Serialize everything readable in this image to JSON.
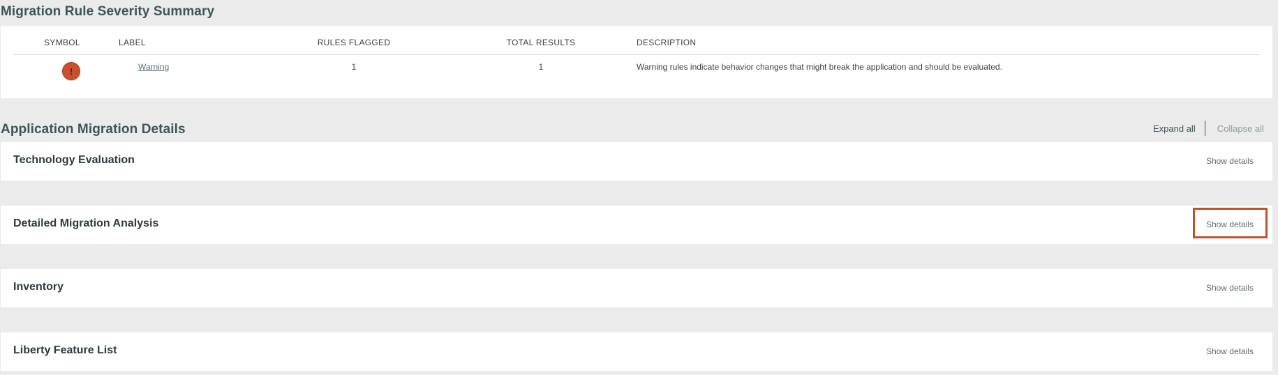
{
  "summary": {
    "title": "Migration Rule Severity Summary",
    "columns": {
      "symbol": "SYMBOL",
      "label": "LABEL",
      "rules_flagged": "RULES FLAGGED",
      "total_results": "TOTAL RESULTS",
      "description": "DESCRIPTION"
    },
    "rows": [
      {
        "symbol_icon": "warning-icon",
        "symbol_color": "#c9502f",
        "label": "Warning",
        "rules_flagged": "1",
        "total_results": "1",
        "description": "Warning rules indicate behavior changes that might break the application and should be evaluated."
      }
    ]
  },
  "details": {
    "title": "Application Migration Details",
    "expand_all": "Expand all",
    "collapse_all": "Collapse all",
    "panels": [
      {
        "title": "Technology Evaluation",
        "action": "Show details"
      },
      {
        "title": "Detailed Migration Analysis",
        "action": "Show details",
        "highlighted": true
      },
      {
        "title": "Inventory",
        "action": "Show details"
      },
      {
        "title": "Liberty Feature List",
        "action": "Show details"
      }
    ]
  },
  "colors": {
    "page_background": "#ebebeb",
    "card_background": "#ffffff",
    "heading": "#3f5458",
    "highlight": "#c1502c"
  }
}
